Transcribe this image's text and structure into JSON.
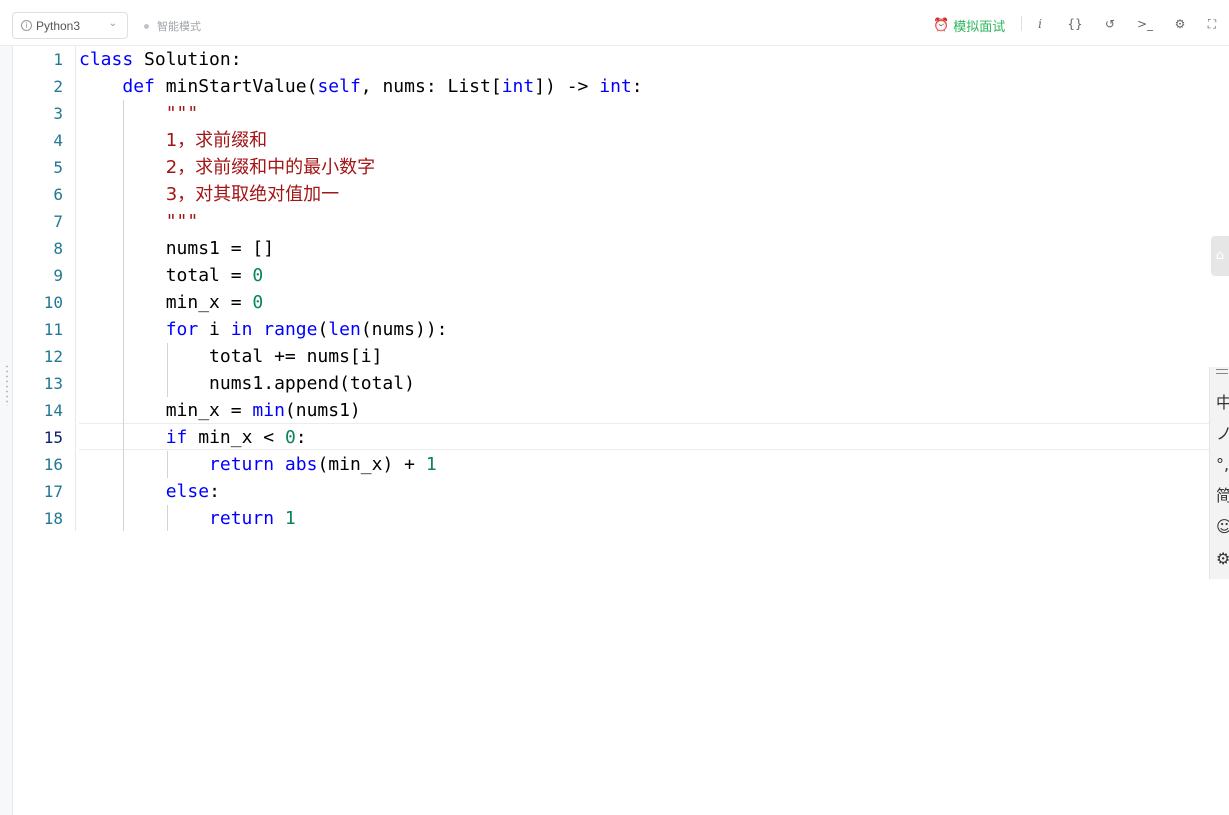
{
  "toolbar": {
    "language": "Python3",
    "mode": "智能模式",
    "mock_interview": "模拟面试",
    "icons": [
      "info-icon",
      "braces-icon",
      "reset-icon",
      "console-icon",
      "settings-icon",
      "fullscreen-icon"
    ]
  },
  "editor": {
    "line_numbers": [
      "1",
      "2",
      "3",
      "4",
      "5",
      "6",
      "7",
      "8",
      "9",
      "10",
      "11",
      "12",
      "13",
      "14",
      "15",
      "16",
      "17",
      "18"
    ],
    "current_line": 15,
    "lines": [
      [
        {
          "t": "class",
          "c": "kw"
        },
        {
          "t": " Solution:"
        }
      ],
      [
        {
          "t": "    "
        },
        {
          "t": "def",
          "c": "kw"
        },
        {
          "t": " minStartValue("
        },
        {
          "t": "self",
          "c": "kw"
        },
        {
          "t": ", nums: List["
        },
        {
          "t": "int",
          "c": "kw"
        },
        {
          "t": "]) -> "
        },
        {
          "t": "int",
          "c": "kw"
        },
        {
          "t": ":"
        }
      ],
      [
        {
          "t": "        "
        },
        {
          "t": "\"\"\"",
          "c": "str"
        }
      ],
      [
        {
          "t": "        "
        },
        {
          "t": "1，求前缀和",
          "c": "str"
        }
      ],
      [
        {
          "t": "        "
        },
        {
          "t": "2，求前缀和中的最小数字",
          "c": "str"
        }
      ],
      [
        {
          "t": "        "
        },
        {
          "t": "3，对其取绝对值加一",
          "c": "str"
        }
      ],
      [
        {
          "t": "        "
        },
        {
          "t": "\"\"\"",
          "c": "str"
        }
      ],
      [
        {
          "t": "        nums1 = []"
        }
      ],
      [
        {
          "t": "        total = "
        },
        {
          "t": "0",
          "c": "num"
        }
      ],
      [
        {
          "t": "        min_x = "
        },
        {
          "t": "0",
          "c": "num"
        }
      ],
      [
        {
          "t": "        "
        },
        {
          "t": "for",
          "c": "kw"
        },
        {
          "t": " i "
        },
        {
          "t": "in",
          "c": "kw"
        },
        {
          "t": " "
        },
        {
          "t": "range",
          "c": "kw"
        },
        {
          "t": "("
        },
        {
          "t": "len",
          "c": "kw"
        },
        {
          "t": "(nums)):"
        }
      ],
      [
        {
          "t": "            total += nums[i]"
        }
      ],
      [
        {
          "t": "            nums1.append(total)"
        }
      ],
      [
        {
          "t": "        min_x = "
        },
        {
          "t": "min",
          "c": "kw"
        },
        {
          "t": "(nums1)"
        }
      ],
      [
        {
          "t": "        "
        },
        {
          "t": "if",
          "c": "kw"
        },
        {
          "t": " min_x < "
        },
        {
          "t": "0",
          "c": "num"
        },
        {
          "t": ":"
        }
      ],
      [
        {
          "t": "            "
        },
        {
          "t": "return",
          "c": "kw"
        },
        {
          "t": " "
        },
        {
          "t": "abs",
          "c": "kw"
        },
        {
          "t": "(min_x) + "
        },
        {
          "t": "1",
          "c": "num"
        }
      ],
      [
        {
          "t": "        "
        },
        {
          "t": "else",
          "c": "kw"
        },
        {
          "t": ":"
        }
      ],
      [
        {
          "t": "            "
        },
        {
          "t": "return",
          "c": "kw"
        },
        {
          "t": " "
        },
        {
          "t": "1",
          "c": "num"
        }
      ]
    ]
  },
  "colors": {
    "keyword": "#0000ff",
    "number": "#098658",
    "string": "#a31515",
    "line_number": "#237893",
    "accent_green": "#2db55d"
  },
  "ime_bar": {
    "items": [
      "中",
      "ノ",
      "°,",
      "简",
      "☺",
      "⚙"
    ]
  },
  "side_tab": {
    "icon": "⌂"
  }
}
